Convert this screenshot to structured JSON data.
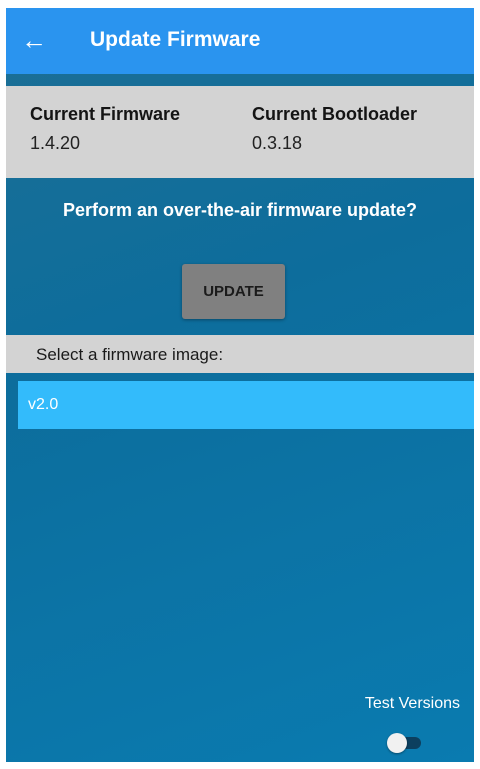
{
  "app_bar": {
    "back_icon": "arrow-left-icon",
    "back_glyph": "←",
    "title": "Update Firmware",
    "color": "#2a94ef"
  },
  "versions": {
    "firmware_label": "Current Firmware",
    "firmware_value": "1.4.20",
    "bootloader_label": "Current Bootloader",
    "bootloader_value": "0.3.18"
  },
  "update": {
    "prompt": "Perform an over-the-air firmware update?",
    "button_label": "UPDATE"
  },
  "image_list": {
    "header": "Select a firmware image:",
    "items": [
      {
        "label": "v2.0",
        "selected": true
      }
    ],
    "selected_color": "#33bbfb"
  },
  "test_versions": {
    "label": "Test Versions",
    "enabled": false
  }
}
